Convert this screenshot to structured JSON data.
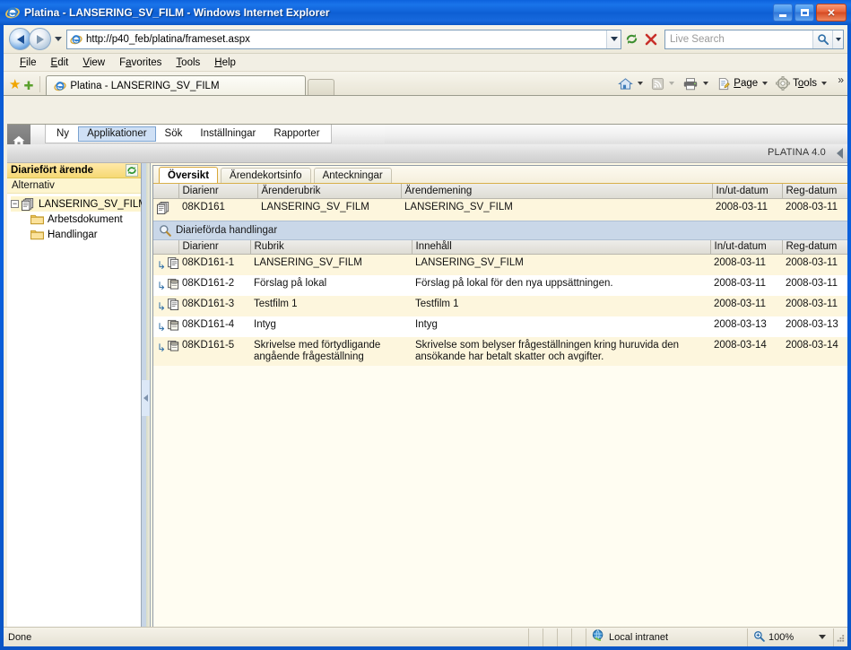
{
  "window": {
    "title": "Platina - LANSERING_SV_FILM - Windows Internet Explorer",
    "minimize_label": "Minimize",
    "maximize_label": "Maximize",
    "close_label": "Close",
    "app_icon": "ie-logo-icon"
  },
  "navigation": {
    "back_label": "Back",
    "forward_label": "Forward",
    "recent_pages_label": "Recent Pages",
    "url": "http://p40_feb/platina/frameset.aspx",
    "refresh_label": "Refresh",
    "stop_label": "Stop",
    "search_placeholder": "Live Search",
    "search_value": ""
  },
  "menu": {
    "items": [
      {
        "label": "File",
        "accel": "F"
      },
      {
        "label": "Edit",
        "accel": "E"
      },
      {
        "label": "View",
        "accel": "V"
      },
      {
        "label": "Favorites",
        "accel": "a"
      },
      {
        "label": "Tools",
        "accel": "T"
      },
      {
        "label": "Help",
        "accel": "H"
      }
    ]
  },
  "favorites_bar": {
    "add_favorite_label": "Add to Favorites",
    "favorites_center_label": "Favorites Center"
  },
  "browser_tabs": {
    "tabs": [
      {
        "label": "Platina - LANSERING_SV_FILM",
        "active": true
      }
    ],
    "new_tab_label": "New Tab"
  },
  "command_bar": {
    "home_label": "Home",
    "feeds_label": "Feeds",
    "print_label": "Print",
    "page_label": "Page",
    "tools_label": "Tools",
    "more_label": "»"
  },
  "app": {
    "home_label": "Home",
    "version_label": "PLATINA 4.0",
    "collapse_label": "Collapse panel",
    "nav_tabs": [
      {
        "label": "Ny",
        "active": false
      },
      {
        "label": "Applikationer",
        "active": true
      },
      {
        "label": "Sök",
        "active": false
      },
      {
        "label": "Inställningar",
        "active": false
      },
      {
        "label": "Rapporter",
        "active": false
      }
    ]
  },
  "sidebar": {
    "title": "Diariefört ärende",
    "refresh_label": "Uppdatera",
    "alternativ_label": "Alternativ",
    "tree": {
      "expander": "−",
      "root": {
        "label": "LANSERING_SV_FILM",
        "icon": "case-document-icon"
      },
      "children": [
        {
          "label": "Arbetsdokument",
          "icon": "folder-icon"
        },
        {
          "label": "Handlingar",
          "icon": "folder-icon"
        }
      ]
    }
  },
  "content": {
    "tabs": [
      {
        "label": "Översikt",
        "active": true
      },
      {
        "label": "Ärendekortsinfo",
        "active": false
      },
      {
        "label": "Anteckningar",
        "active": false
      }
    ],
    "case_table": {
      "columns": [
        "",
        "Diarienr",
        "Ärenderubrik",
        "Ärendemening",
        "In/ut-datum",
        "Reg-datum"
      ],
      "rows": [
        {
          "icon": "case-document-icon",
          "diarienr": "08KD161",
          "arenderubrik": "LANSERING_SV_FILM",
          "arendemening": "LANSERING_SV_FILM",
          "in_ut_datum": "2008-03-11",
          "reg_datum": "2008-03-11"
        }
      ]
    },
    "section_header": {
      "icon": "magnifier-icon",
      "label": "Diarieförda handlingar"
    },
    "documents_table": {
      "columns": [
        "",
        "Diarienr",
        "Rubrik",
        "Innehåll",
        "In/ut-datum",
        "Reg-datum"
      ],
      "rows": [
        {
          "icon": "document-copy-icon",
          "diarienr": "08KD161-1",
          "rubrik": "LANSERING_SV_FILM",
          "innehall": "LANSERING_SV_FILM",
          "in_ut_datum": "2008-03-11",
          "reg_datum": "2008-03-11"
        },
        {
          "icon": "media-copy-icon",
          "diarienr": "08KD161-2",
          "rubrik": "Förslag på lokal",
          "innehall": "Förslag på lokal för den nya uppsättningen.",
          "in_ut_datum": "2008-03-11",
          "reg_datum": "2008-03-11"
        },
        {
          "icon": "document-copy-icon",
          "diarienr": "08KD161-3",
          "rubrik": "Testfilm 1",
          "innehall": "Testfilm 1",
          "in_ut_datum": "2008-03-11",
          "reg_datum": "2008-03-11"
        },
        {
          "icon": "media-copy-icon",
          "diarienr": "08KD161-4",
          "rubrik": "Intyg",
          "innehall": "Intyg",
          "in_ut_datum": "2008-03-13",
          "reg_datum": "2008-03-13"
        },
        {
          "icon": "media-copy-icon",
          "diarienr": "08KD161-5",
          "rubrik": "Skrivelse med förtydligande angående frågeställning",
          "innehall": "Skrivelse som belyser frågeställningen kring huruvida den ansökande har betalt skatter och avgifter.",
          "in_ut_datum": "2008-03-14",
          "reg_datum": "2008-03-14"
        }
      ]
    }
  },
  "statusbar": {
    "status_text": "Done",
    "zone_icon": "globe-icon",
    "zone_label": "Local intranet",
    "zoom_icon": "magnifier-plus-icon",
    "zoom_label": "100%"
  },
  "colors": {
    "accent_blue": "#0a58d0",
    "sidebar_header": "#f6d974",
    "row_yellow": "#fdf6dd",
    "section_blue": "#c9d7e8",
    "active_navtab": "#cfe0f5"
  }
}
